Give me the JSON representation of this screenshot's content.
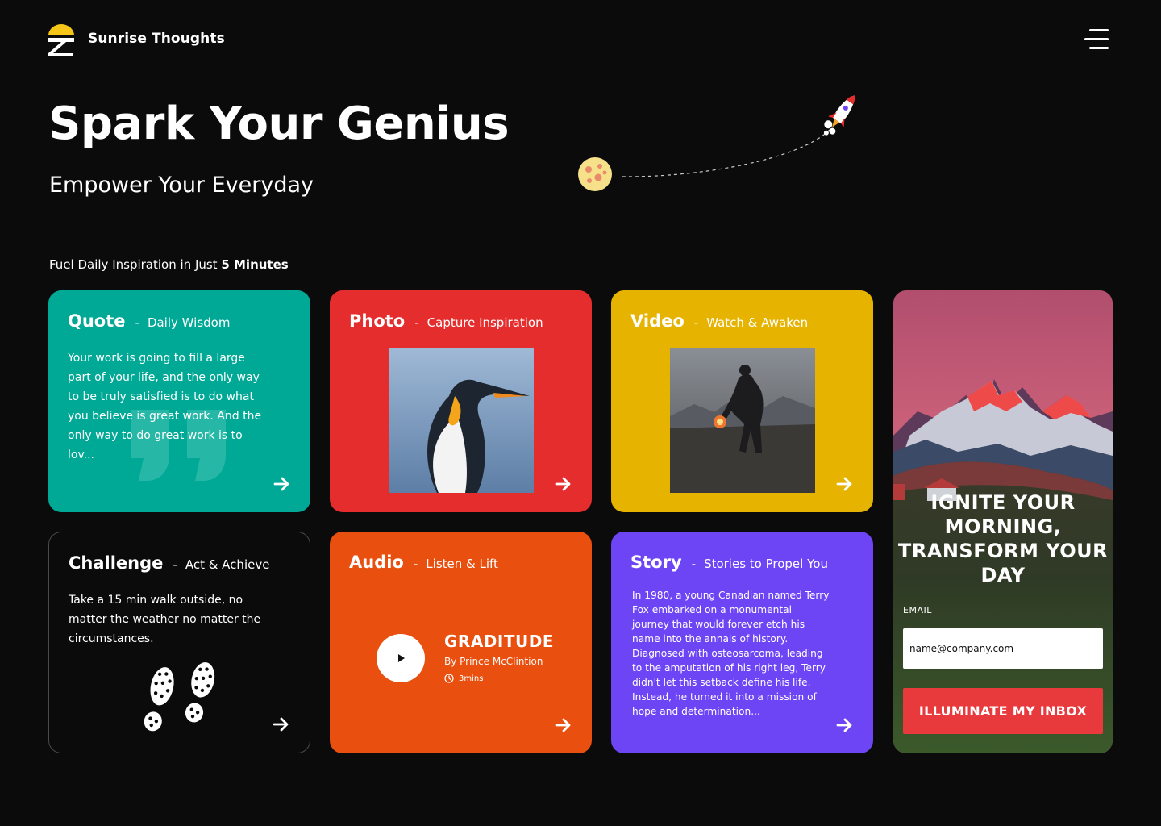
{
  "header": {
    "brand": "Sunrise Thoughts",
    "menu_icon": "hamburger-menu-icon"
  },
  "hero": {
    "title": "Spark Your Genius",
    "subtitle": "Empower Your Everyday"
  },
  "intro": {
    "text": "Fuel Daily Inspiration in Just ",
    "emphasis": "5 Minutes"
  },
  "cards": {
    "quote": {
      "title": "Quote",
      "separator": "-",
      "subtitle": "Daily Wisdom",
      "body": "Your work is going to fill a large part of your life, and the only way to be truly satisfied is to do what you believe is great work. And the only way to do great work is to lov..."
    },
    "photo": {
      "title": "Photo",
      "separator": "-",
      "subtitle": "Capture Inspiration"
    },
    "video": {
      "title": "Video",
      "separator": "-",
      "subtitle": "Watch & Awaken"
    },
    "challenge": {
      "title": "Challenge",
      "separator": "-",
      "subtitle": "Act & Achieve",
      "body": "Take a 15 min walk outside, no matter the weather no matter the circumstances."
    },
    "audio": {
      "title": "Audio",
      "separator": "-",
      "subtitle": "Listen & Lift",
      "track_title": "GRADITUDE",
      "author": "By Prince McClintion",
      "duration": "3mins"
    },
    "story": {
      "title": "Story",
      "separator": "-",
      "subtitle": "Stories to Propel You",
      "body": "In 1980, a young Canadian named Terry Fox embarked on a monumental journey that would forever etch his name into the annals of history. Diagnosed with osteosarcoma, leading to the amputation of his right leg, Terry didn't let this setback define his life. Instead, he turned it into a mission of hope and determination..."
    }
  },
  "signup": {
    "title": "IGNITE YOUR MORNING, TRANSFORM YOUR DAY",
    "email_label": "EMAIL",
    "email_value": "name@company.com",
    "button": "ILLUMINATE MY INBOX"
  },
  "colors": {
    "background": "#0b0b0b",
    "quote": "#00a896",
    "photo": "#e52d2d",
    "video": "#e6b400",
    "audio": "#e9500f",
    "story": "#6d45f5",
    "cta": "#e8393d"
  }
}
